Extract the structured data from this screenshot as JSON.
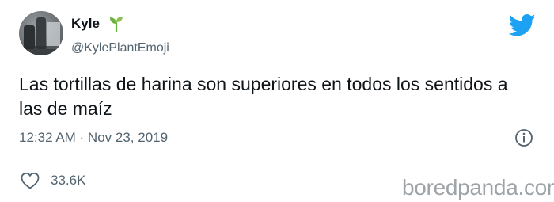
{
  "author": {
    "name": "Kyle",
    "name_emoji": "seedling-icon",
    "handle": "@KylePlantEmoji"
  },
  "platform_icon": "twitter-bird-icon",
  "tweet": {
    "text": "Las tortillas de harina son superiores en todos los sentidos a las de maíz",
    "timestamp": "12:32 AM · Nov 23, 2019"
  },
  "actions": {
    "like_icon": "heart-icon",
    "like_count": "33.6K",
    "info_icon": "info-icon"
  },
  "watermark": "boredpanda.com",
  "colors": {
    "text": "#0f1419",
    "secondary": "#536471",
    "twitter_blue": "#1da1f2",
    "sprout_green": "#6db33f",
    "divider": "#e6ecf0",
    "watermark": "#9ea3a7"
  }
}
